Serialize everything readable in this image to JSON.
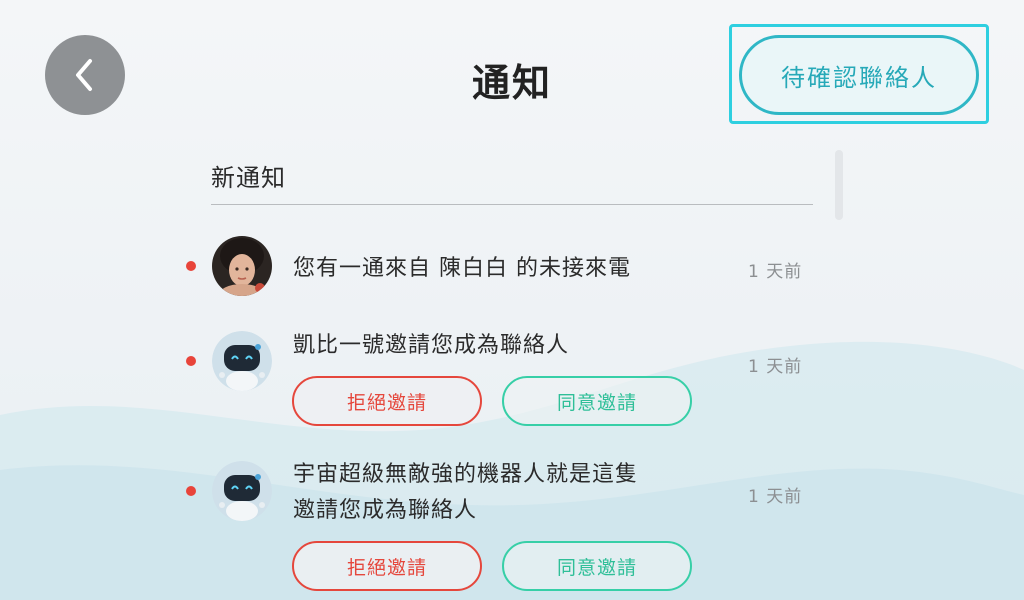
{
  "header": {
    "back_icon": "chevron-left-icon",
    "title": "通知",
    "pending_contacts_label": "待確認聯絡人"
  },
  "section": {
    "label": "新通知"
  },
  "notifications": [
    {
      "message": "您有一通來自 陳白白 的未接來電",
      "time": "1 天前",
      "unread": true,
      "avatar": "person-photo"
    },
    {
      "message": "凱比一號邀請您成為聯絡人",
      "time": "1 天前",
      "unread": true,
      "avatar": "robot-avatar",
      "reject_label": "拒絕邀請",
      "accept_label": "同意邀請"
    },
    {
      "message_line1": "宇宙超級無敵強的機器人就是這隻",
      "message_line2": "邀請您成為聯絡人",
      "time": "1 天前",
      "unread": true,
      "avatar": "robot-avatar",
      "reject_label": "拒絕邀請",
      "accept_label": "同意邀請"
    }
  ],
  "colors": {
    "accent": "#2fb7c6",
    "reject": "#e5473c",
    "accept": "#37cfa7",
    "unread_dot": "#e8443a",
    "back_button": "#8e9194"
  }
}
